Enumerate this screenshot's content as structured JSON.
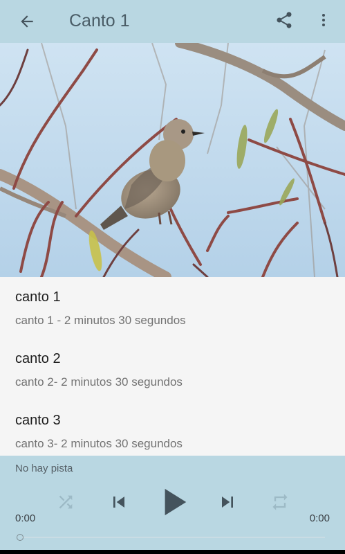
{
  "app_bar": {
    "title": "Canto 1",
    "icons": [
      "arrow-back-icon",
      "share-icon",
      "more-vert-icon"
    ]
  },
  "header_image": {
    "subject": "bird-on-branch-photo"
  },
  "tracks": [
    {
      "name": "canto 1",
      "description": "canto 1 - 2 minutos 30 segundos"
    },
    {
      "name": "canto 2",
      "description": "canto 2- 2 minutos 30 segundos"
    },
    {
      "name": "canto 3",
      "description": "canto 3- 2 minutos 30 segundos"
    }
  ],
  "player": {
    "status": "No hay pista",
    "elapsed": "0:00",
    "duration": "0:00",
    "progress": 0,
    "controls": [
      "shuffle-icon",
      "skip-previous-icon",
      "play-icon",
      "skip-next-icon",
      "repeat-icon"
    ]
  },
  "colors": {
    "bar_background": "#b9d7e2",
    "list_background": "#f5f5f5",
    "icon_dark": "#44535c",
    "icon_disabled": "#9dbac6"
  }
}
